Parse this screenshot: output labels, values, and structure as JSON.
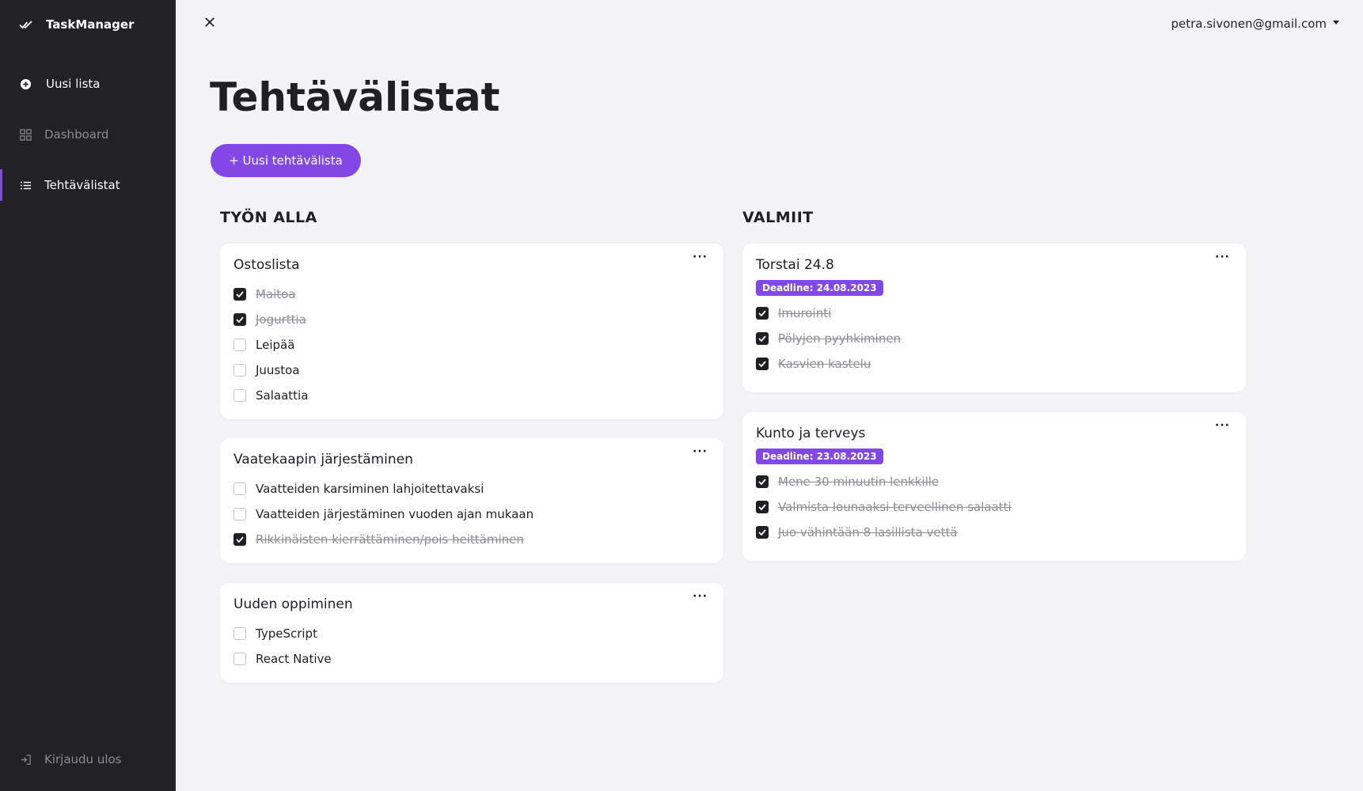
{
  "sidebar": {
    "brand": "TaskManager",
    "new_list": "Uusi lista",
    "dashboard": "Dashboard",
    "lists": "Tehtävälistat",
    "logout": "Kirjaudu ulos"
  },
  "header": {
    "user": "petra.sivonen@gmail.com"
  },
  "main": {
    "title": "Tehtävälistat",
    "new_button": "+ Uusi tehtävälista",
    "in_progress_title": "TYÖN ALLA",
    "done_title": "VALMIIT",
    "more_label": "···"
  },
  "in_progress": [
    {
      "title": "Ostoslista",
      "items": [
        {
          "label": "Maitoa",
          "done": true
        },
        {
          "label": "Jogurttia",
          "done": true
        },
        {
          "label": "Leipää",
          "done": false
        },
        {
          "label": "Juustoa",
          "done": false
        },
        {
          "label": "Salaattia",
          "done": false
        }
      ]
    },
    {
      "title": "Vaatekaapin järjestäminen",
      "items": [
        {
          "label": "Vaatteiden karsiminen lahjoitettavaksi",
          "done": false
        },
        {
          "label": "Vaatteiden järjestäminen vuoden ajan mukaan",
          "done": false
        },
        {
          "label": "Rikkinäisten kierrättäminen/pois heittäminen",
          "done": true
        }
      ]
    },
    {
      "title": "Uuden oppiminen",
      "items": [
        {
          "label": "TypeScript",
          "done": false
        },
        {
          "label": "React Native",
          "done": false
        }
      ]
    }
  ],
  "completed": [
    {
      "title": "Torstai 24.8",
      "deadline": "Deadline: 24.08.2023",
      "items": [
        {
          "label": "Imurointi",
          "done": true
        },
        {
          "label": "Pölyjen pyyhkiminen",
          "done": true
        },
        {
          "label": "Kasvien kastelu",
          "done": true
        }
      ]
    },
    {
      "title": "Kunto ja terveys",
      "deadline": "Deadline: 23.08.2023",
      "items": [
        {
          "label": "Mene 30 minuutin lenkkille",
          "done": true
        },
        {
          "label": "Valmista lounaaksi terveellinen salaatti",
          "done": true
        },
        {
          "label": "Juo vähintään 8 lasillista vettä",
          "done": true
        }
      ]
    }
  ],
  "colors": {
    "accent": "#8248e5",
    "sidebar_bg": "#222226",
    "page_bg": "#f4f4f6"
  }
}
